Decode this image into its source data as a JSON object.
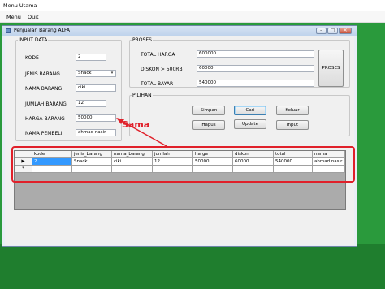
{
  "outer": {
    "title": "Menu Utama",
    "menu": [
      "Menu",
      "Quit"
    ]
  },
  "window": {
    "title": "Penjualan Barang ALFA"
  },
  "input_data": {
    "legend": "INPUT DATA",
    "fields": [
      {
        "label": "KODE",
        "value": "2"
      },
      {
        "label": "JENIS BARANG",
        "value": "Snack"
      },
      {
        "label": "NAMA BARANG",
        "value": "ciki"
      },
      {
        "label": "JUMLAH BARANG",
        "value": "12"
      },
      {
        "label": "HARGA BARANG",
        "value": "50000"
      },
      {
        "label": "NAMA PEMBELI",
        "value": "ahmad nasir"
      }
    ]
  },
  "proses": {
    "legend": "PROSES",
    "fields": [
      {
        "label": "TOTAL HARGA",
        "value": "600000"
      },
      {
        "label": "DISKON > 500RB",
        "value": "60000"
      },
      {
        "label": "TOTAL BAYAR",
        "value": "540000"
      }
    ],
    "button": "PROSES"
  },
  "pilihan": {
    "legend": "PILIHAN",
    "buttons": [
      "Simpan",
      "Cari",
      "Keluar",
      "Hapus",
      "Update",
      "Input"
    ]
  },
  "grid": {
    "columns": [
      "kode",
      "jenis_barang",
      "nama_barang",
      "jumlah",
      "harga",
      "diskon",
      "total",
      "nama"
    ],
    "rows": [
      [
        "2",
        "Snack",
        "ciki",
        "12",
        "50000",
        "60000",
        "540000",
        "ahmad nasir"
      ]
    ],
    "new_row_marker": "*",
    "current_row_marker": "▶"
  },
  "annotation": {
    "text": "Sama",
    "color": "#e0202a"
  },
  "colors": {
    "desktop": "#2a9a3c",
    "selected_cell": "#3399ff"
  }
}
